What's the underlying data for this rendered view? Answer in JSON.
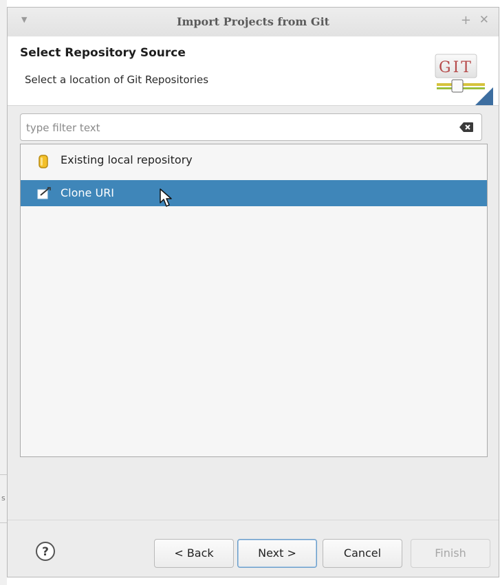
{
  "window": {
    "title": "Import Projects from Git"
  },
  "header": {
    "title": "Select Repository Source",
    "description": "Select a location of Git Repositories",
    "logo_text": "GIT"
  },
  "filter": {
    "placeholder": "type filter text",
    "value": ""
  },
  "sources": {
    "items": [
      {
        "label": "Existing local repository",
        "icon": "repository-cylinder-icon",
        "selected": false
      },
      {
        "label": "Clone URI",
        "icon": "clone-uri-icon",
        "selected": true
      }
    ]
  },
  "buttons": {
    "back": "< Back",
    "next": "Next >",
    "cancel": "Cancel",
    "finish": "Finish"
  },
  "colors": {
    "selection": "#3f86b9",
    "dialog_bg": "#ececec",
    "list_bg": "#f6f6f6"
  }
}
